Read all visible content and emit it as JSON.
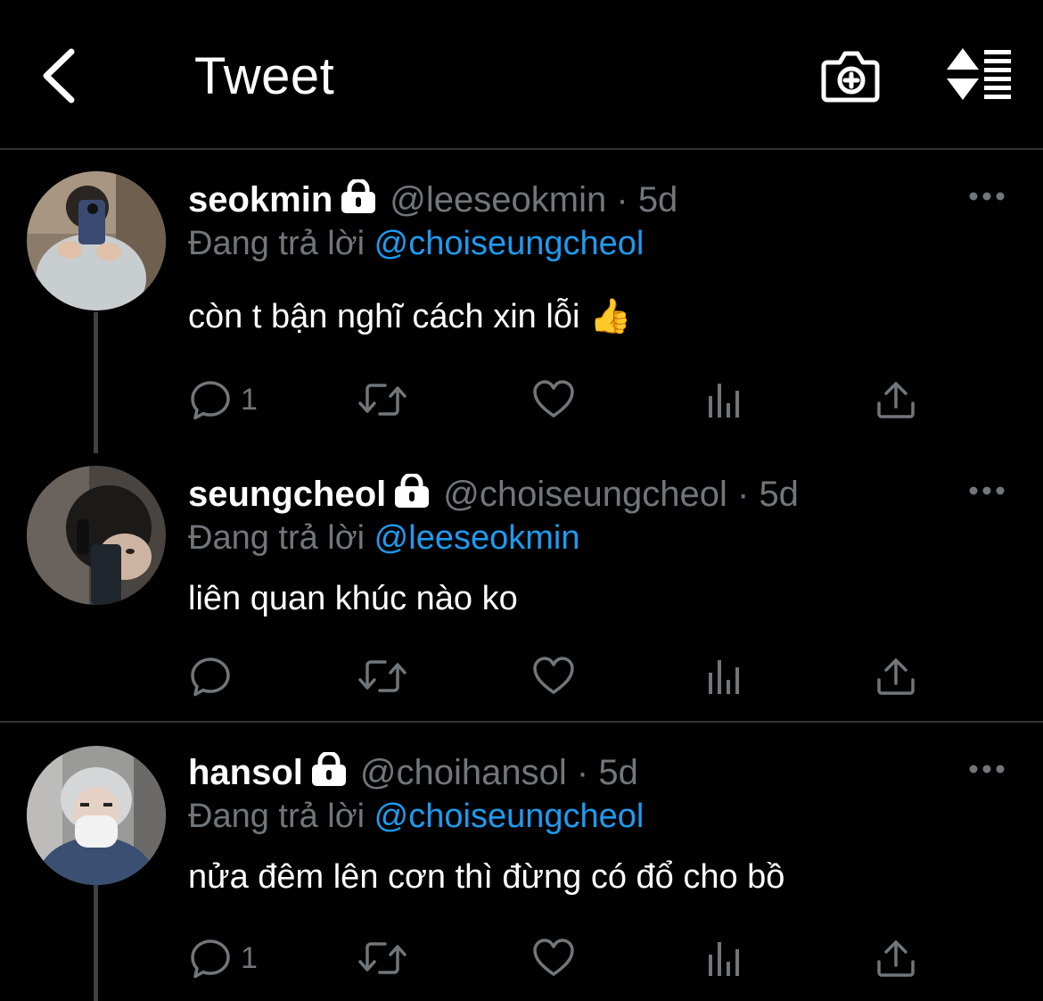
{
  "header": {
    "title": "Tweet"
  },
  "colors": {
    "link": "#1d9bf0",
    "muted": "#71767b",
    "background": "#000000"
  },
  "tweets": [
    {
      "display_name": "seokmin",
      "handle": "@leeseokmin",
      "separator": "·",
      "time": "5d",
      "reply_prefix": "Đang trả lời",
      "reply_to": "@choiseungcheol",
      "text": "còn t bận nghĩ cách xin lỗi 👍",
      "reply_count": "1"
    },
    {
      "display_name": "seungcheol",
      "handle": "@choiseungcheol",
      "separator": "·",
      "time": "5d",
      "reply_prefix": "Đang trả lời",
      "reply_to": "@leeseokmin",
      "text": "liên quan khúc nào ko",
      "reply_count": ""
    },
    {
      "display_name": "hansol",
      "handle": "@choihansol",
      "separator": "·",
      "time": "5d",
      "reply_prefix": "Đang trả lời",
      "reply_to": "@choiseungcheol",
      "text": "nửa đêm lên cơn thì đừng có đổ cho bồ",
      "reply_count": "1"
    }
  ]
}
